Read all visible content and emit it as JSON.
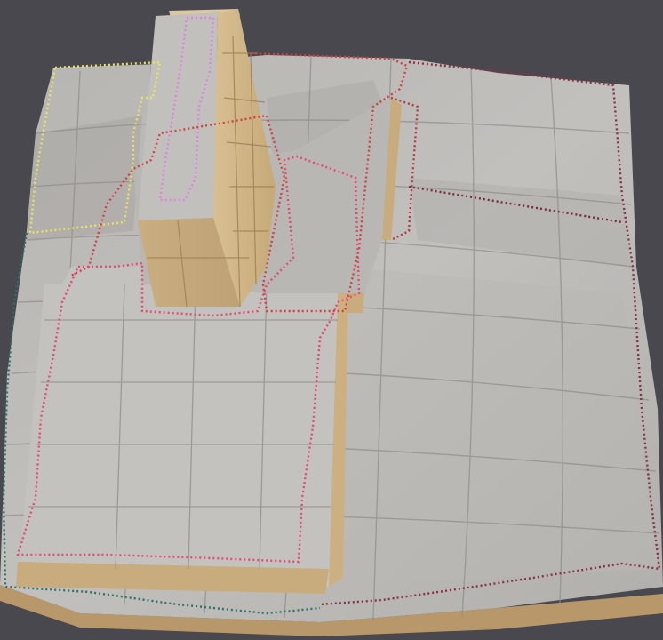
{
  "scene": {
    "background_color": "#49484e",
    "terrain_fill": "#bdbbb8",
    "terrain_shadow": "#a9a7a4",
    "terrain_grid": "#8c8a86",
    "wall_color": "#c8ab7c",
    "wall_dark": "#a98d63",
    "region_colors": {
      "yellow": "#e6e25a",
      "violet": "#d77ad8",
      "pink": "#e0456a",
      "red": "#c83a3a",
      "maroon": "#7a2a3a",
      "teal": "#2b6b63"
    }
  }
}
